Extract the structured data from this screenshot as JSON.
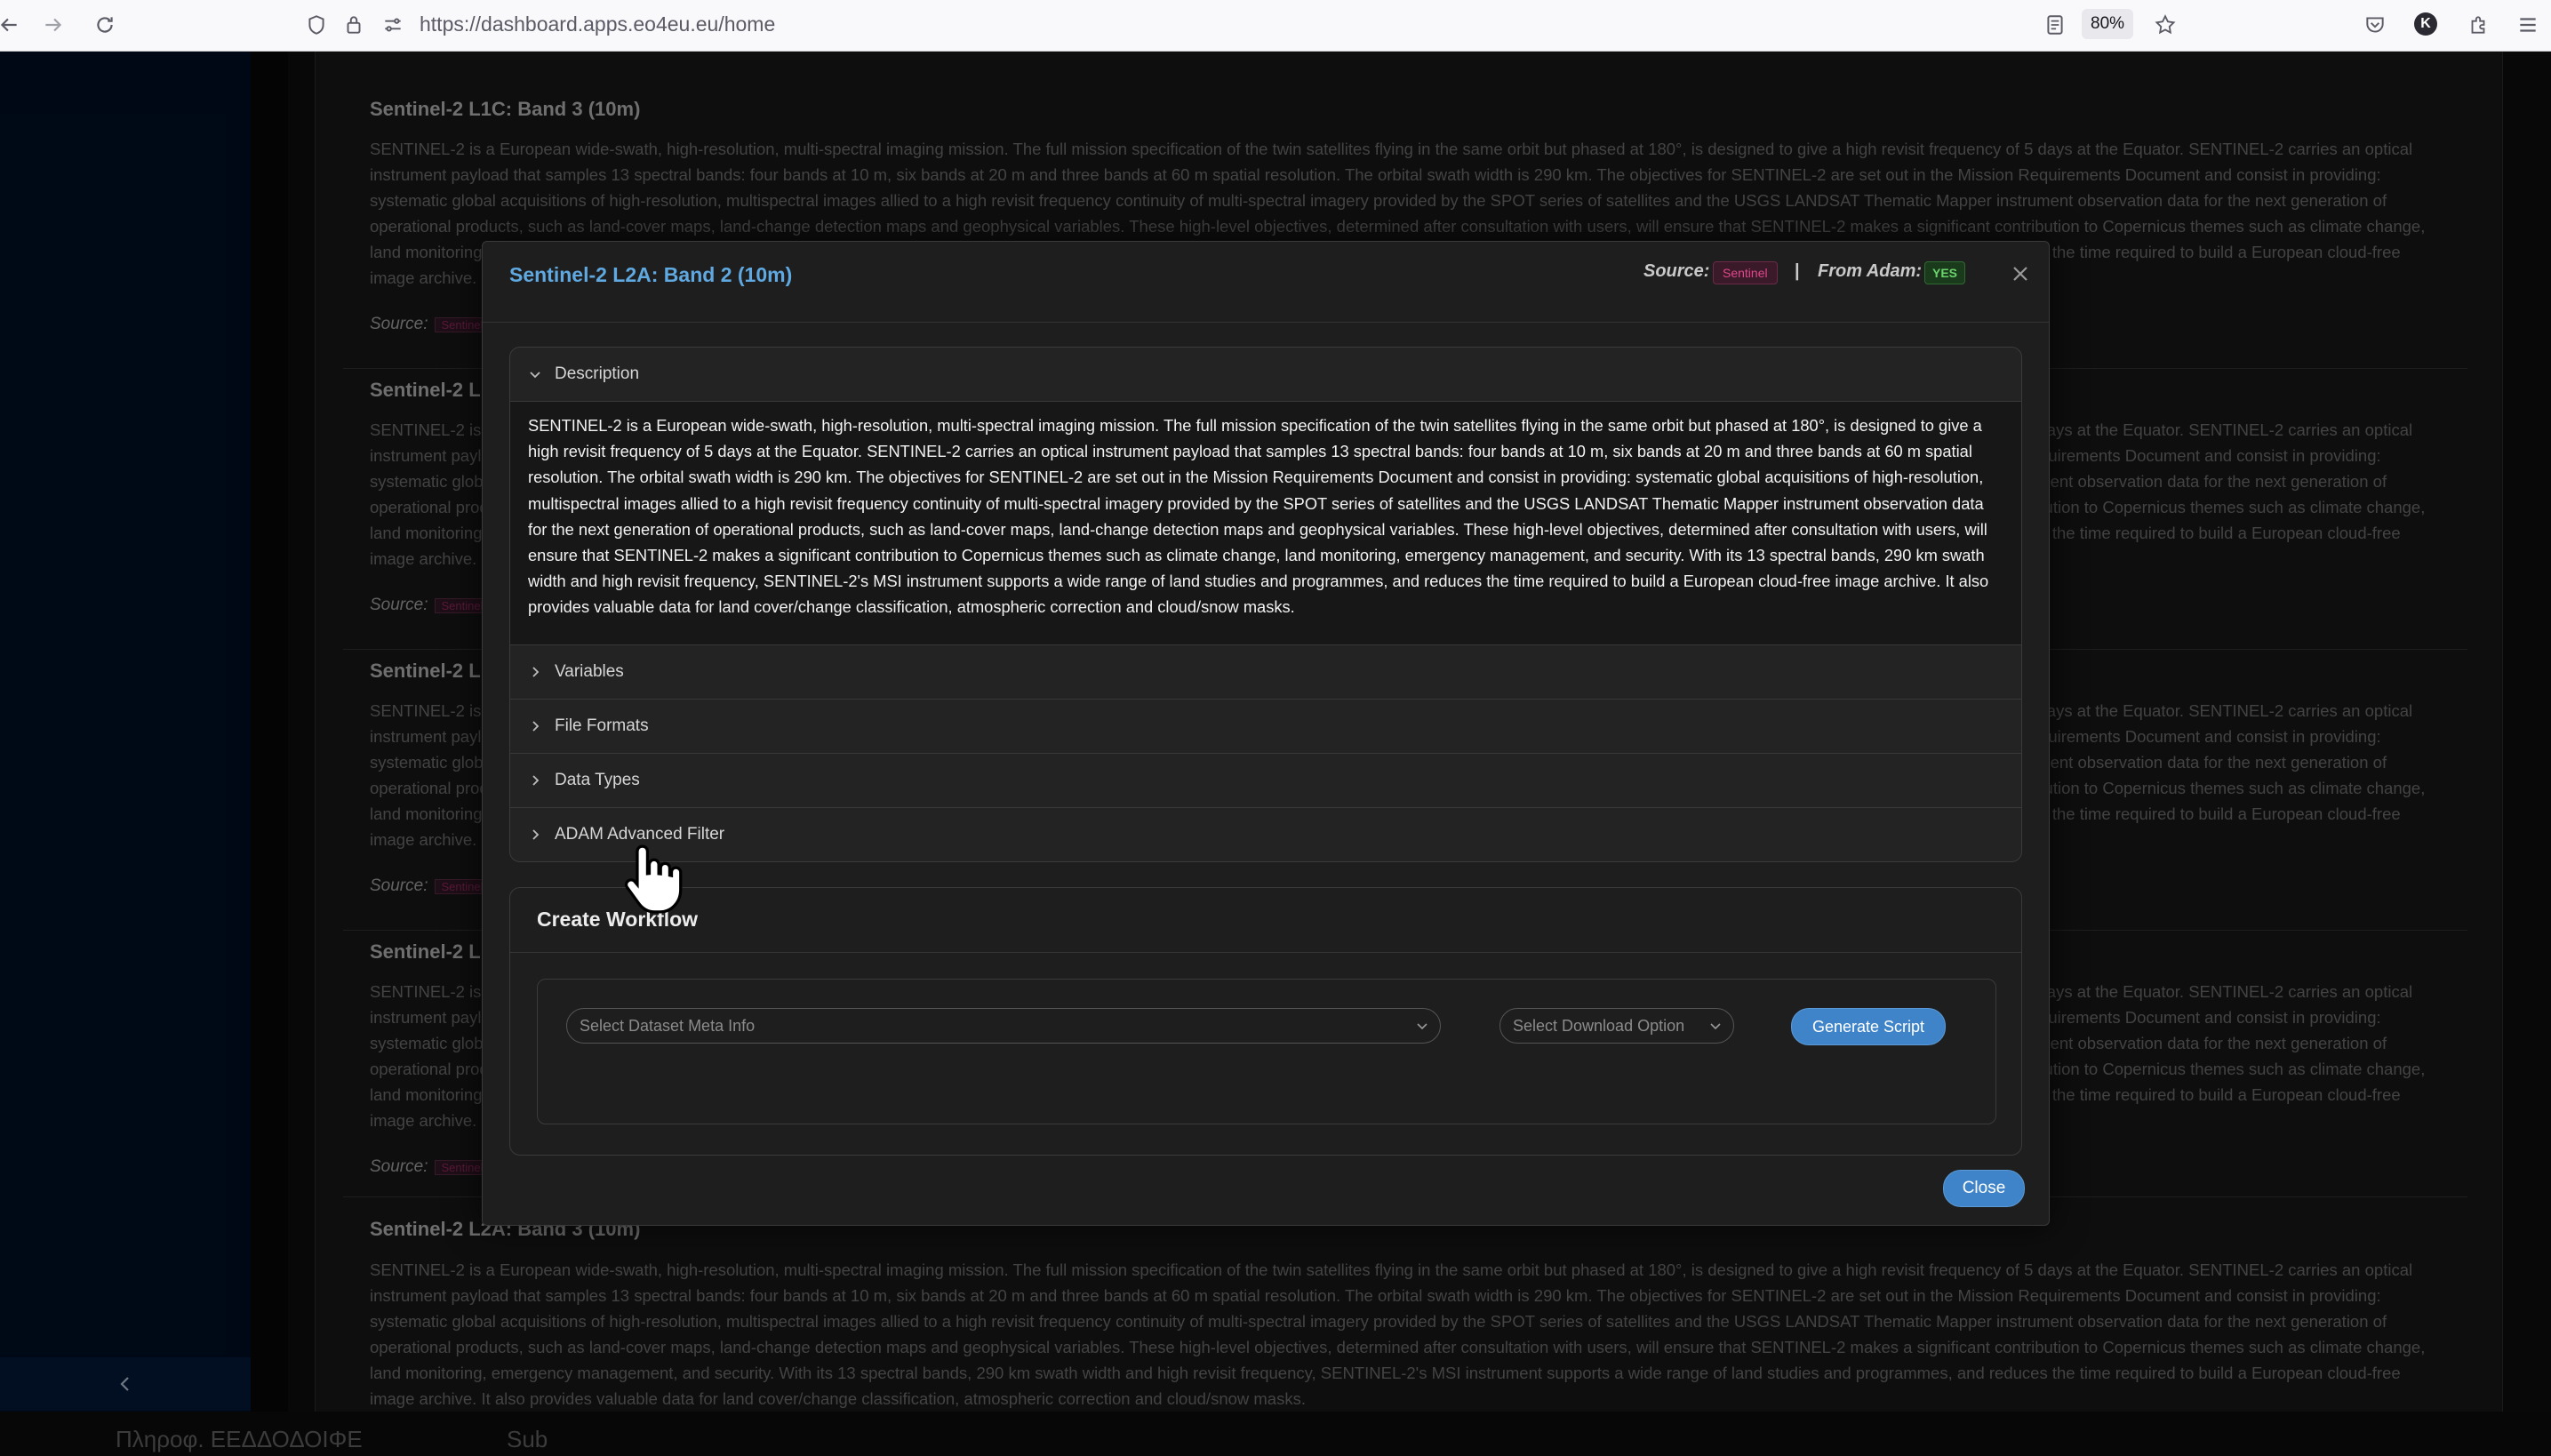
{
  "browser": {
    "url": "https://dashboard.apps.eo4eu.eu/home",
    "zoom": "80%",
    "profile_initial": "K"
  },
  "background_cards": [
    {
      "title": "Sentinel-2 L1C: Band 3 (10m)",
      "text": "SENTINEL-2 is a European wide-swath, high-resolution, multi-spectral imaging mission. The full mission specification of the twin satellites flying in the same orbit but phased at 180°, is designed to give a high revisit frequency of 5 days at the Equator. SENTINEL-2 carries an optical instrument payload that samples 13 spectral bands: four bands at 10 m, six bands at 20 m and three bands at 60 m spatial resolution. The orbital swath width is 290 km. The objectives for SENTINEL-2 are set out in the Mission Requirements Document and consist in providing: systematic global acquisitions of high-resolution, multispectral images allied to a high revisit frequency continuity of multi-spectral imagery provided by the SPOT series of satellites and the USGS LANDSAT Thematic Mapper instrument observation data for the next generation of operational products, such as land-cover maps, land-change detection maps and geophysical variables. These high-level objectives, determined after consultation with users, will ensure that SENTINEL-2 makes a significant contribution to Copernicus themes such as climate change, land monitoring, emergency management, and security. With its 13 spectral bands, 290 km swath width and high revisit frequency, SENTINEL-2's MSI instrument supports a wide range of land studies and programmes, and reduces the time required to build a European cloud-free image archive.",
      "source_label": "Source:",
      "source_tag": "Sentinel"
    },
    {
      "title": "Sentinel-2 L",
      "text": "SENTINEL-2 is a European wide-swath, high-resolution, multi-spectral imaging mission. The full mission specification of the twin satellites flying in the same orbit but phased at 180°, is designed to give a high revisit frequency of 5 days at the Equator. SENTINEL-2 carries an optical instrument payload that samples 13 spectral bands: four bands at 10 m, six bands at 20 m and three bands at 60 m spatial resolution. The orbital swath width is 290 km. The objectives for SENTINEL-2 are set out in the Mission Requirements Document and consist in providing: systematic global acquisitions of high-resolution, multispectral images allied to a high revisit frequency continuity of multi-spectral imagery provided by the SPOT series of satellites and the USGS LANDSAT Thematic Mapper instrument observation data for the next generation of operational products, such as land-cover maps, land-change detection maps and geophysical variables. These high-level objectives, determined after consultation with users, will ensure that SENTINEL-2 makes a significant contribution to Copernicus themes such as climate change, land monitoring, emergency management, and security. With its 13 spectral bands, 290 km swath width and high revisit frequency, SENTINEL-2's MSI instrument supports a wide range of land studies and programmes, and reduces the time required to build a European cloud-free image archive.",
      "source_label": "Source:",
      "source_tag": "Sentinel"
    },
    {
      "title": "Sentinel-2 L",
      "text": "SENTINEL-2 is a European wide-swath, high-resolution, multi-spectral imaging mission. The full mission specification of the twin satellites flying in the same orbit but phased at 180°, is designed to give a high revisit frequency of 5 days at the Equator. SENTINEL-2 carries an optical instrument payload that samples 13 spectral bands: four bands at 10 m, six bands at 20 m and three bands at 60 m spatial resolution. The orbital swath width is 290 km. The objectives for SENTINEL-2 are set out in the Mission Requirements Document and consist in providing: systematic global acquisitions of high-resolution, multispectral images allied to a high revisit frequency continuity of multi-spectral imagery provided by the SPOT series of satellites and the USGS LANDSAT Thematic Mapper instrument observation data for the next generation of operational products, such as land-cover maps, land-change detection maps and geophysical variables. These high-level objectives, determined after consultation with users, will ensure that SENTINEL-2 makes a significant contribution to Copernicus themes such as climate change, land monitoring, emergency management, and security. With its 13 spectral bands, 290 km swath width and high revisit frequency, SENTINEL-2's MSI instrument supports a wide range of land studies and programmes, and reduces the time required to build a European cloud-free image archive.",
      "source_label": "Source:",
      "source_tag": "Sentinel"
    },
    {
      "title": "Sentinel-2 L",
      "text": "SENTINEL-2 is a European wide-swath, high-resolution, multi-spectral imaging mission. The full mission specification of the twin satellites flying in the same orbit but phased at 180°, is designed to give a high revisit frequency of 5 days at the Equator. SENTINEL-2 carries an optical instrument payload that samples 13 spectral bands: four bands at 10 m, six bands at 20 m and three bands at 60 m spatial resolution. The orbital swath width is 290 km. The objectives for SENTINEL-2 are set out in the Mission Requirements Document and consist in providing: systematic global acquisitions of high-resolution, multispectral images allied to a high revisit frequency continuity of multi-spectral imagery provided by the SPOT series of satellites and the USGS LANDSAT Thematic Mapper instrument observation data for the next generation of operational products, such as land-cover maps, land-change detection maps and geophysical variables. These high-level objectives, determined after consultation with users, will ensure that SENTINEL-2 makes a significant contribution to Copernicus themes such as climate change, land monitoring, emergency management, and security. With its 13 spectral bands, 290 km swath width and high revisit frequency, SENTINEL-2's MSI instrument supports a wide range of land studies and programmes, and reduces the time required to build a European cloud-free image archive.",
      "source_label": "Source:",
      "source_tag": "Sentinel"
    },
    {
      "title": "Sentinel-2 L2A: Band 3 (10m)",
      "text": "SENTINEL-2 is a European wide-swath, high-resolution, multi-spectral imaging mission. The full mission specification of the twin satellites flying in the same orbit but phased at 180°, is designed to give a high revisit frequency of 5 days at the Equator. SENTINEL-2 carries an optical instrument payload that samples 13 spectral bands: four bands at 10 m, six bands at 20 m and three bands at 60 m spatial resolution. The orbital swath width is 290 km. The objectives for SENTINEL-2 are set out in the Mission Requirements Document and consist in providing: systematic global acquisitions of high-resolution, multispectral images allied to a high revisit frequency continuity of multi-spectral imagery provided by the SPOT series of satellites and the USGS LANDSAT Thematic Mapper instrument observation data for the next generation of operational products, such as land-cover maps, land-change detection maps and geophysical variables. These high-level objectives, determined after consultation with users, will ensure that SENTINEL-2 makes a significant contribution to Copernicus themes such as climate change, land monitoring, emergency management, and security. With its 13 spectral bands, 290 km swath width and high revisit frequency, SENTINEL-2's MSI instrument supports a wide range of land studies and programmes, and reduces the time required to build a European cloud-free image archive. It also provides valuable data for land cover/change classification, atmospheric correction and cloud/snow masks.",
      "source_label": "",
      "source_tag": ""
    }
  ],
  "bottom_strip": {
    "left_text": "Πληροφ. ΕΕΔΔΟΔΟΙΦΕ",
    "right_text": "Sub"
  },
  "modal": {
    "title": "Sentinel-2 L2A: Band 2 (10m)",
    "source_label": "Source:",
    "source_tag": "Sentinel",
    "separator": "|",
    "adam_label": "From Adam:",
    "adam_tag": "YES",
    "accordion": {
      "description_label": "Description",
      "description_text": "SENTINEL-2 is a European wide-swath, high-resolution, multi-spectral imaging mission. The full mission specification of the twin satellites flying in the same orbit but phased at 180°, is designed to give a high revisit frequency of 5 days at the Equator. SENTINEL-2 carries an optical instrument payload that samples 13 spectral bands: four bands at 10 m, six bands at 20 m and three bands at 60 m spatial resolution. The orbital swath width is 290 km. The objectives for SENTINEL-2 are set out in the Mission Requirements Document and consist in providing: systematic global acquisitions of high-resolution, multispectral images allied to a high revisit frequency continuity of multi-spectral imagery provided by the SPOT series of satellites and the USGS LANDSAT Thematic Mapper instrument observation data for the next generation of operational products, such as land-cover maps, land-change detection maps and geophysical variables. These high-level objectives, determined after consultation with users, will ensure that SENTINEL-2 makes a significant contribution to Copernicus themes such as climate change, land monitoring, emergency management, and security. With its 13 spectral bands, 290 km swath width and high revisit frequency, SENTINEL-2's MSI instrument supports a wide range of land studies and programmes, and reduces the time required to build a European cloud-free image archive. It also provides valuable data for land cover/change classification, atmospheric correction and cloud/snow masks.",
      "variables_label": "Variables",
      "file_formats_label": "File Formats",
      "data_types_label": "Data Types",
      "adam_filter_label": "ADAM Advanced Filter"
    },
    "workflow": {
      "title": "Create Workflow",
      "meta_placeholder": "Select Dataset Meta Info",
      "download_placeholder": "Select Download Option",
      "generate_label": "Generate Script"
    },
    "close_label": "Close"
  },
  "colors": {
    "accent": "#3f84c8",
    "modal_title": "#5fa8e0",
    "source_tag": "#e0468c",
    "adam_tag": "#6bd36b",
    "sidebar": "#000c1e"
  },
  "icons": [
    "back-icon",
    "forward-icon",
    "reload-icon",
    "shield-icon",
    "lock-icon",
    "permissions-icon",
    "reader-icon",
    "star-icon",
    "pocket-icon",
    "extensions-icon",
    "menu-icon",
    "collapse-icon",
    "close-icon",
    "chevron-down-icon",
    "chevron-right-icon",
    "hand-cursor-icon"
  ]
}
